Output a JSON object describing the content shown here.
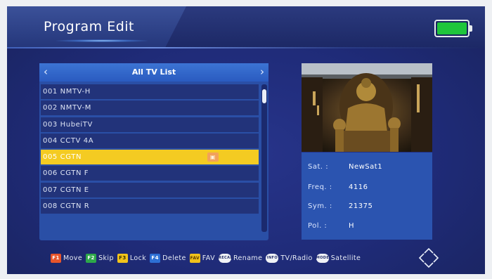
{
  "header": {
    "title": "Program Edit"
  },
  "status": {
    "battery_icon": "battery-full-icon",
    "battery_color": "#1fc53c"
  },
  "channel_list": {
    "title": "All TV List",
    "prev_icon": "chevron-left-icon",
    "next_icon": "chevron-right-icon",
    "items": [
      {
        "label": "001 NMTV-H"
      },
      {
        "label": "002 NMTV-M"
      },
      {
        "label": "003 HubeiTV"
      },
      {
        "label": "004 CCTV 4A"
      },
      {
        "label": "005 CGTN",
        "selected": true,
        "badge_icon": "lock-icon"
      },
      {
        "label": "006 CGTN F"
      },
      {
        "label": "007 CGTN E"
      },
      {
        "label": "008 CGTN R"
      }
    ],
    "selected_color": "#f4cb22"
  },
  "info": {
    "sat_label": "Sat. :",
    "sat_value": "NewSat1",
    "freq_label": "Freq. :",
    "freq_value": "4116",
    "sym_label": "Sym. :",
    "sym_value": "21375",
    "pol_label": "Pol. :",
    "pol_value": "H"
  },
  "footer": {
    "items": [
      {
        "key": "F1",
        "label": "Move",
        "color": "#e8552b"
      },
      {
        "key": "F2",
        "label": "Skip",
        "color": "#2ea84a"
      },
      {
        "key": "F3",
        "label": "Lock",
        "color": "#f2c31a"
      },
      {
        "key": "F4",
        "label": "Delete",
        "color": "#2d6fd4"
      },
      {
        "key": "FAV",
        "label": "FAV",
        "color": "#f0c11c"
      },
      {
        "key": "RECALL",
        "label": "Rename"
      },
      {
        "key": "INFO",
        "label": "TV/Radio"
      },
      {
        "key": "MODE",
        "label": "Satellite"
      }
    ],
    "nav_icon": "dpad-navigation-icon"
  }
}
